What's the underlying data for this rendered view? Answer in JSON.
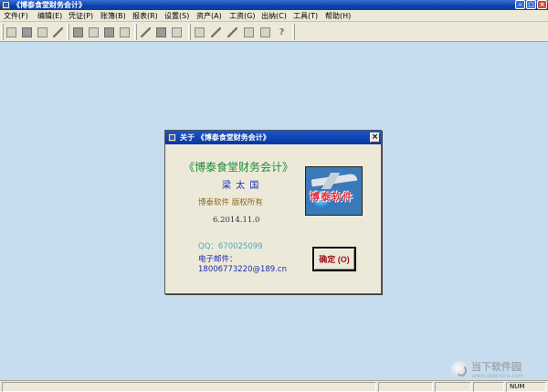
{
  "window": {
    "title": "《博泰食堂财务会计》"
  },
  "menu": [
    {
      "label": "文件(F)"
    },
    {
      "label": "编辑(E)"
    },
    {
      "label": "凭证(P)"
    },
    {
      "label": "账簿(B)"
    },
    {
      "label": "报表(R)"
    },
    {
      "label": "设置(S)"
    },
    {
      "label": "资产(A)"
    },
    {
      "label": "工资(G)"
    },
    {
      "label": "出纳(C)"
    },
    {
      "label": "工具(T)"
    },
    {
      "label": "帮助(H)"
    }
  ],
  "toolbar": {
    "icons": [
      "journal-icon",
      "voucher-icon",
      "ledger-icon",
      "report-icon",
      "asset-icon",
      "salary-icon",
      "cashier-icon",
      "grid-icon",
      "settings-icon",
      "edit-icon",
      "export-icon",
      "print-icon",
      "save-icon",
      "pen-icon",
      "cut-icon",
      "copy-icon",
      "paste-icon",
      "help-icon"
    ]
  },
  "status": {
    "num": "NUM"
  },
  "watermark": {
    "text": "当下软件园",
    "sub": "www.downxia.com"
  },
  "dialog": {
    "title": "关于 《博泰食堂财务会计》",
    "product": "《博泰食堂财务会计》",
    "author": "梁 太 国",
    "copyright": "博泰软件   版权所有",
    "version": "6.2014.11.0",
    "qq": "QQ：670025099",
    "email_label": "电子邮件：",
    "email": "18006773220@189.cn",
    "logo_text": "博泰软件",
    "ok_label": "确定 (O)"
  },
  "colors": {
    "desktop": "#c6ddf0",
    "titlebar": "#0a3fa8",
    "product_text": "#1c8c3a",
    "ok_text": "#a0141e"
  }
}
